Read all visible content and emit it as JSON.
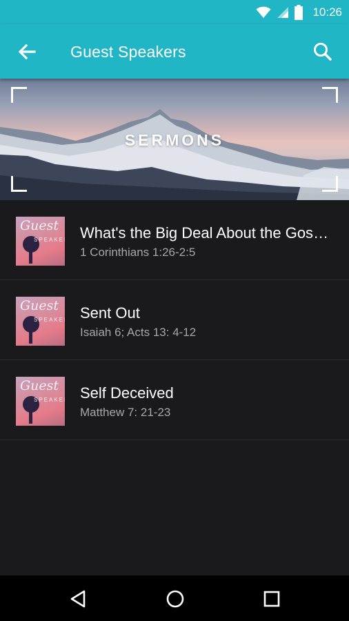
{
  "status_bar": {
    "time": "10:26",
    "icons": [
      "wifi-icon",
      "signal-icon",
      "battery-icon"
    ]
  },
  "app_bar": {
    "title": "Guest Speakers",
    "back_icon": "arrow-back-icon",
    "search_icon": "search-icon",
    "color": "#21b6c6"
  },
  "banner": {
    "text": "SERMONS"
  },
  "sermons": [
    {
      "title": "What's the Big Deal About the Gospel?",
      "reference": "1 Corinthians 1:26-2:5",
      "thumb_text_1": "Guest",
      "thumb_text_2": "SPEAKER"
    },
    {
      "title": "Sent Out",
      "reference": "Isaiah 6; Acts 13: 4-12",
      "thumb_text_1": "Guest",
      "thumb_text_2": "SPEAKER"
    },
    {
      "title": "Self Deceived",
      "reference": "Matthew 7: 21-23",
      "thumb_text_1": "Guest",
      "thumb_text_2": "SPEAKER"
    }
  ],
  "nav_bar": {
    "icons": [
      "nav-back-icon",
      "nav-home-icon",
      "nav-recents-icon"
    ]
  }
}
